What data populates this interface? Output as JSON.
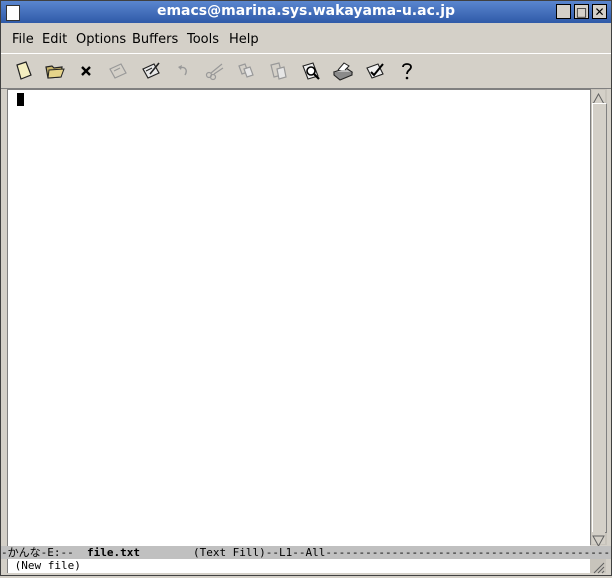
{
  "window": {
    "title": "emacs@marina.sys.wakayama-u.ac.jp",
    "minimize_glyph": "_",
    "maximize_glyph": "□",
    "close_glyph": "✕"
  },
  "menu": [
    "File",
    "Edit",
    "Options",
    "Buffers",
    "Tools",
    "Help"
  ],
  "toolbar": [
    {
      "icon": "new-file-icon",
      "enabled": true
    },
    {
      "icon": "open-folder-icon",
      "enabled": true
    },
    {
      "icon": "close-buffer-icon",
      "enabled": true
    },
    {
      "icon": "save-icon",
      "enabled": false
    },
    {
      "icon": "save-as-icon",
      "enabled": true
    },
    {
      "icon": "undo-icon",
      "enabled": false
    },
    {
      "icon": "cut-icon",
      "enabled": false
    },
    {
      "icon": "copy-icon",
      "enabled": false
    },
    {
      "icon": "paste-icon",
      "enabled": false
    },
    {
      "icon": "search-icon",
      "enabled": true
    },
    {
      "icon": "print-icon",
      "enabled": true
    },
    {
      "icon": "preferences-icon",
      "enabled": true
    },
    {
      "icon": "help-icon",
      "enabled": true
    }
  ],
  "modeline": {
    "prefix": "-かんな-E:--  ",
    "buffer_name": "file.txt",
    "rest": "        (Text Fill)--L1--All-------------------------------------------"
  },
  "minibuffer": {
    "message": " (New file)"
  }
}
